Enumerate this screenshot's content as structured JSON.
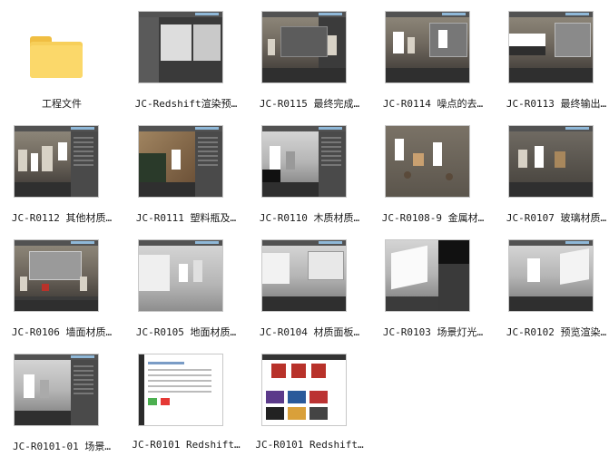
{
  "files": [
    {
      "label": "工程文件",
      "type": "folder",
      "folder_color": "#f7cf5a"
    },
    {
      "label": "JC-Redshift渲染预…",
      "type": "image"
    },
    {
      "label": "JC-R0115 最终完成…",
      "type": "image"
    },
    {
      "label": "JC-R0114 噪点的去…",
      "type": "image"
    },
    {
      "label": "JC-R0113 最终输出…",
      "type": "image"
    },
    {
      "label": "JC-R0112 其他材质…",
      "type": "image"
    },
    {
      "label": "JC-R0111 塑料瓶及…",
      "type": "image"
    },
    {
      "label": "JC-R0110 木质材质…",
      "type": "image"
    },
    {
      "label": "JC-R0108-9 金属材…",
      "type": "image"
    },
    {
      "label": "JC-R0107 玻璃材质…",
      "type": "image"
    },
    {
      "label": "JC-R0106 墙面材质…",
      "type": "image"
    },
    {
      "label": "JC-R0105 地面材质…",
      "type": "image"
    },
    {
      "label": "JC-R0104 材质面板…",
      "type": "image"
    },
    {
      "label": "JC-R0103 场景灯光…",
      "type": "image"
    },
    {
      "label": "JC-R0102 预览渲染…",
      "type": "image"
    },
    {
      "label": "JC-R0101-01 场景…",
      "type": "image"
    },
    {
      "label": "JC-R0101 Redshift…",
      "type": "image"
    },
    {
      "label": "JC-R0101 Redshift…",
      "type": "image"
    }
  ]
}
